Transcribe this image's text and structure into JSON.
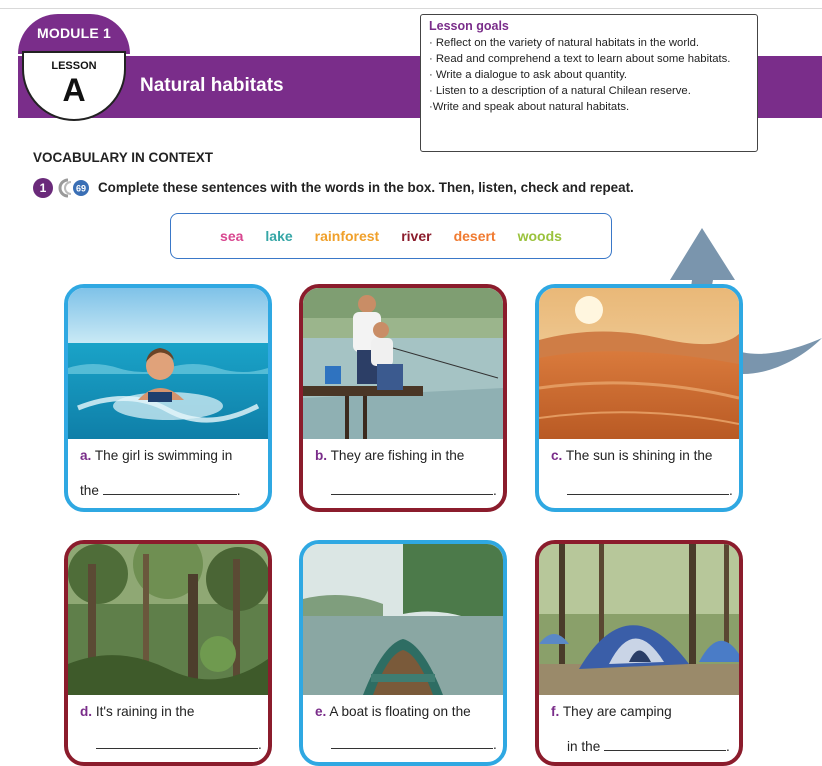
{
  "header": {
    "module": "MODULE 1",
    "lesson_word": "LESSON",
    "lesson_letter": "A",
    "title": "Natural habitats"
  },
  "goals": {
    "title": "Lesson goals",
    "items": [
      "· Reflect on the variety of natural habitats in the world.",
      "· Read and comprehend a text to learn about some habitats.",
      "· Write a dialogue to ask about quantity.",
      "· Listen to a description of a natural Chilean reserve.",
      "·Write and speak about natural habitats."
    ]
  },
  "section": {
    "heading": "VOCABULARY IN CONTEXT",
    "number": "1",
    "track": "69",
    "instruction": "Complete these sentences with the words in the box. Then, listen, check and repeat."
  },
  "wordbox": [
    {
      "word": "sea",
      "color": "#d8468f"
    },
    {
      "word": "lake",
      "color": "#35a6a6"
    },
    {
      "word": "rainforest",
      "color": "#f0a02a"
    },
    {
      "word": "river",
      "color": "#8b1c2c"
    },
    {
      "word": "desert",
      "color": "#f07a30"
    },
    {
      "word": "woods",
      "color": "#9ac23c"
    }
  ],
  "cards": {
    "a": {
      "letter": "a.",
      "text": " The girl is swimming in",
      "blank_prefix": "the "
    },
    "b": {
      "letter": "b.",
      "text": " They are fishing in the",
      "blank_prefix": ""
    },
    "c": {
      "letter": "c.",
      "text": " The sun is shining in the",
      "blank_prefix": ""
    },
    "d": {
      "letter": "d.",
      "text": " It's raining in the",
      "blank_prefix": ""
    },
    "e": {
      "letter": "e.",
      "text": " A boat is floating on the",
      "blank_prefix": ""
    },
    "f": {
      "letter": "f.",
      "text": " They are camping",
      "blank_prefix": "in the "
    }
  },
  "colors": {
    "purple": "#7a2d8a",
    "card_blue": "#2fa8e2",
    "card_red": "#8b1c2c",
    "wordbox_border": "#3a78c8"
  }
}
